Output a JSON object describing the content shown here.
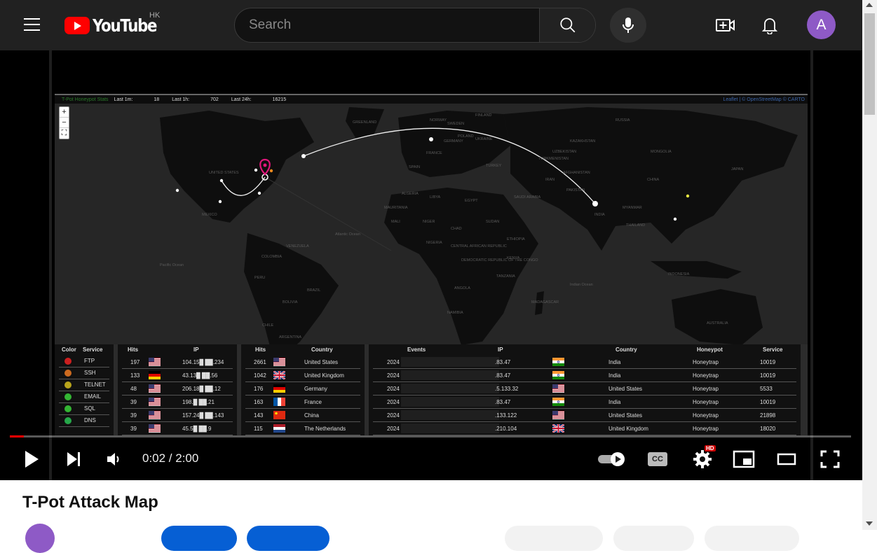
{
  "header": {
    "logo_text": "YouTube",
    "country_code": "HK",
    "search_placeholder": "Search",
    "avatar_letter": "A",
    "icons": [
      "menu-icon",
      "search-icon",
      "mic-icon",
      "create-icon",
      "bell-icon"
    ]
  },
  "map": {
    "brand": "T-Pot Honeypot Stats",
    "last_1m_label": "Last 1m:",
    "last_1m": "18",
    "last_1h_label": "Last 1h:",
    "last_1h": "702",
    "last_24h_label": "Last 24h:",
    "last_24h": "16215",
    "attribution": "Leaflet | © OpenStreetMap © CARTO",
    "zoom_in": "+",
    "zoom_out": "−",
    "fullscreen": "⛶",
    "country_labels": [
      "UNITED STATES",
      "MEXICO",
      "BRAZIL",
      "COLOMBIA",
      "PERU",
      "BOLIVIA",
      "VENEZUELA",
      "ARGENTINA",
      "CHILE",
      "FRANCE",
      "SPAIN",
      "UKRAINE",
      "KAZAKHSTAN",
      "RUSSIA",
      "MONGOLIA",
      "CHINA",
      "INDIA",
      "IRAN",
      "TURKEY",
      "EGYPT",
      "LIBYA",
      "ALGERIA",
      "MALI",
      "NIGER",
      "CHAD",
      "SUDAN",
      "NIGERIA",
      "ETHIOPIA",
      "KENYA",
      "TANZANIA",
      "ANGOLA",
      "NAMIBIA",
      "MADAGASCAR",
      "SAUDI ARABIA",
      "PAKISTAN",
      "AFGHANISTAN",
      "TURKMENISTAN",
      "UZBEKISTAN",
      "MYANMAR",
      "THAILAND",
      "INDONESIA",
      "AUSTRALIA",
      "JAPAN",
      "DEMOCRATIC REPUBLIC OF THE CONGO",
      "CENTRAL AFRICAN REPUBLIC",
      "MAURITANIA",
      "NORWAY",
      "SWEDEN",
      "FINLAND",
      "POLAND",
      "GERMANY",
      "GREENLAND",
      "Atlantic Ocean",
      "Pacific Ocean",
      "Indian Ocean"
    ]
  },
  "service_table": {
    "headers": [
      "Color",
      "Service"
    ],
    "rows": [
      {
        "service": "FTP",
        "color": "#cc1f1f"
      },
      {
        "service": "SSH",
        "color": "#cc6a1f"
      },
      {
        "service": "TELNET",
        "color": "#b8a41c"
      },
      {
        "service": "EMAIL",
        "color": "#33b533"
      },
      {
        "service": "SQL",
        "color": "#33b533"
      },
      {
        "service": "DNS",
        "color": "#26a84a"
      }
    ]
  },
  "ip_table": {
    "headers": [
      "Hits",
      "IP"
    ],
    "rows": [
      {
        "hits": "197",
        "ip": "104.15█ ██.234",
        "flag": "us"
      },
      {
        "hits": "133",
        "ip": "43.13█ ██.56",
        "flag": "de"
      },
      {
        "hits": "48",
        "ip": "206.18█ ██.12",
        "flag": "us"
      },
      {
        "hits": "39",
        "ip": "198.█ ██.21",
        "flag": "us"
      },
      {
        "hits": "39",
        "ip": "157.24█ ██.143",
        "flag": "us"
      },
      {
        "hits": "39",
        "ip": "45.5█ ██.9",
        "flag": "us"
      }
    ]
  },
  "country_table": {
    "headers": [
      "Hits",
      "Country"
    ],
    "rows": [
      {
        "hits": "2661",
        "country": "United States",
        "flag": "us"
      },
      {
        "hits": "1042",
        "country": "United Kingdom",
        "flag": "gb"
      },
      {
        "hits": "176",
        "country": "Germany",
        "flag": "de"
      },
      {
        "hits": "163",
        "country": "France",
        "flag": "fr"
      },
      {
        "hits": "143",
        "country": "China",
        "flag": "cn"
      },
      {
        "hits": "115",
        "country": "The Netherlands",
        "flag": "nl"
      }
    ]
  },
  "events_table": {
    "headers": [
      "Events",
      "IP",
      "Country",
      "Honeypot",
      "Service"
    ],
    "rows": [
      {
        "event": "2024",
        "ip": ".83.47",
        "country": "India",
        "honeypot": "Honeytrap",
        "service": "10019",
        "flag": "in"
      },
      {
        "event": "2024",
        "ip": ".83.47",
        "country": "India",
        "honeypot": "Honeytrap",
        "service": "10019",
        "flag": "in"
      },
      {
        "event": "2024",
        "ip": ".5.133.32",
        "country": "United States",
        "honeypot": "Honeytrap",
        "service": "5533",
        "flag": "us"
      },
      {
        "event": "2024",
        "ip": ".83.47",
        "country": "India",
        "honeypot": "Honeytrap",
        "service": "10019",
        "flag": "in"
      },
      {
        "event": "2024",
        "ip": ".133.122",
        "country": "United States",
        "honeypot": "Honeytrap",
        "service": "21898",
        "flag": "us"
      },
      {
        "event": "2024",
        "ip": ".210.104",
        "country": "United Kingdom",
        "honeypot": "Honeytrap",
        "service": "18020",
        "flag": "gb"
      }
    ]
  },
  "player": {
    "time": "0:02 / 2:00",
    "progress_fraction": 0.0167,
    "hd_badge": "HD",
    "cc_label": "CC"
  },
  "video": {
    "title": "T-Pot Attack Map"
  }
}
